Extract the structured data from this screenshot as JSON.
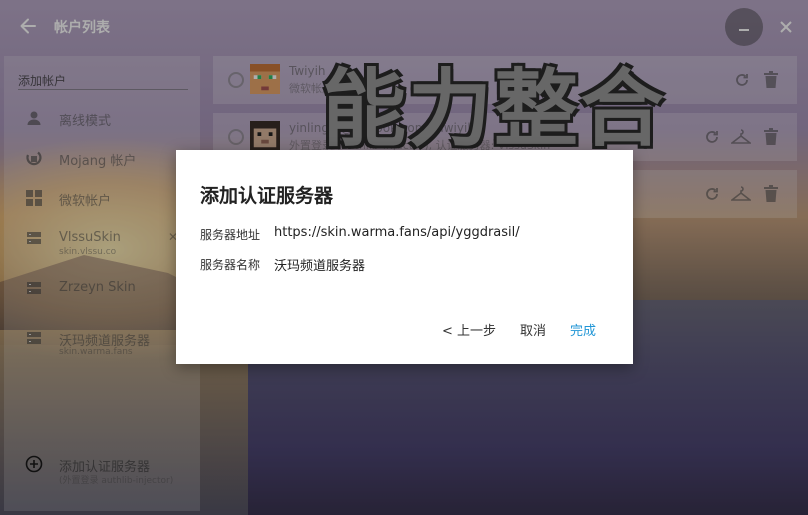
{
  "window": {
    "title": "帐户列表",
    "back_icon": "arrow-left-icon",
    "minimize_icon": "minimize-icon",
    "close_icon": "close-icon"
  },
  "sidebar": {
    "section_label": "添加帐户",
    "items": [
      {
        "label": "离线模式",
        "icon": "person-icon"
      },
      {
        "label": "Mojang 帐户",
        "icon": "mojang-icon"
      },
      {
        "label": "微软帐户",
        "icon": "windows-icon"
      },
      {
        "label": "VlssuSkin",
        "sub": "skin.vlssu.co",
        "icon": "server-icon"
      },
      {
        "label": "Zrzeyn Skin",
        "sub": "",
        "icon": "server-icon"
      },
      {
        "label": "沃玛频道服务器",
        "sub": "skin.warma.fans",
        "icon": "server-icon"
      }
    ],
    "add_server": {
      "label": "添加认证服务器",
      "sub": "(外置登录 authlib-injector)",
      "icon": "add-circle-icon"
    }
  },
  "accounts": [
    {
      "name": "Twiyih",
      "desc": "微软帐户"
    },
    {
      "name": "yinling...@outlook.com - Twiyih",
      "desc": "外置登录 (authlib-injector), 认证服务器: VlssuSkin"
    },
    {
      "name": "",
      "desc": ""
    }
  ],
  "watermark": "能力整合",
  "dialog": {
    "title": "添加认证服务器",
    "server_address_label": "服务器地址",
    "server_address_value": "https://skin.warma.fans/api/yggdrasil/",
    "server_name_label": "服务器名称",
    "server_name_value": "沃玛频道服务器",
    "prev_button": "< 上一步",
    "cancel_button": "取消",
    "finish_button": "完成"
  },
  "colors": {
    "accent": "#2196d6",
    "dialog_bg": "#ffffff"
  }
}
